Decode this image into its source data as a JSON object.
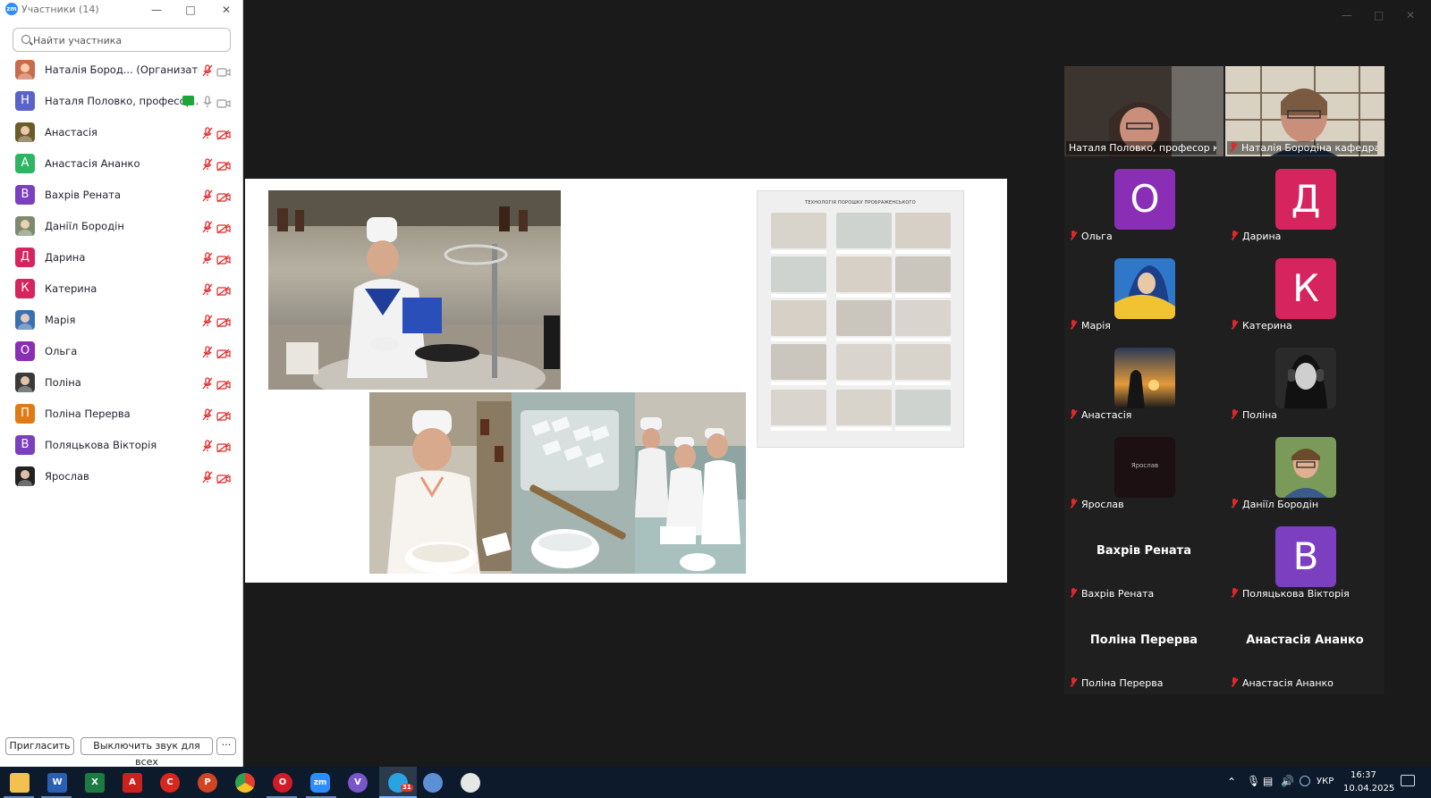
{
  "participants_panel": {
    "title": "Участники (14)",
    "app_icon": "zm",
    "window_controls": [
      "minimize",
      "maximize",
      "close"
    ],
    "search": {
      "placeholder": "Найти участника",
      "value": ""
    },
    "rows": [
      {
        "name": "Наталія Бород... (Организатор, я)",
        "avatar": "photo",
        "avatar_color": "#c96b4a",
        "mic": "muted",
        "camera": "on"
      },
      {
        "name": "Наталя Половко, професор...",
        "avatar": "Н",
        "avatar_color": "#5a63c9",
        "mic": "on",
        "camera": "on",
        "sharing": true
      },
      {
        "name": "Анастасія",
        "avatar": "photo",
        "avatar_color": "#6b5a2a",
        "mic": "muted",
        "camera": "off"
      },
      {
        "name": "Анастасія Ананко",
        "avatar": "А",
        "avatar_color": "#2fb562",
        "mic": "muted",
        "camera": "off"
      },
      {
        "name": "Вахрів Рената",
        "avatar": "В",
        "avatar_color": "#7b3fbf",
        "mic": "muted",
        "camera": "off"
      },
      {
        "name": "Даніїл Бородін",
        "avatar": "photo",
        "avatar_color": "#7c8a6e",
        "mic": "muted",
        "camera": "off"
      },
      {
        "name": "Дарина",
        "avatar": "Д",
        "avatar_color": "#d6245e",
        "mic": "muted",
        "camera": "off"
      },
      {
        "name": "Катерина",
        "avatar": "К",
        "avatar_color": "#d6245e",
        "mic": "muted",
        "camera": "off"
      },
      {
        "name": "Марія",
        "avatar": "photo",
        "avatar_color": "#3a6fb0",
        "mic": "muted",
        "camera": "off"
      },
      {
        "name": "Ольга",
        "avatar": "О",
        "avatar_color": "#8a2fb5",
        "mic": "muted",
        "camera": "off"
      },
      {
        "name": "Поліна",
        "avatar": "photo",
        "avatar_color": "#3a3a3a",
        "mic": "muted",
        "camera": "off"
      },
      {
        "name": "Поліна Перерва",
        "avatar": "П",
        "avatar_color": "#e07a14",
        "mic": "muted",
        "camera": "off"
      },
      {
        "name": "Поляцькова Вікторія",
        "avatar": "В",
        "avatar_color": "#7b3fbf",
        "mic": "muted",
        "camera": "off"
      },
      {
        "name": "Ярослав",
        "avatar": "photo",
        "avatar_color": "#222222",
        "mic": "muted",
        "camera": "off"
      }
    ],
    "buttons": {
      "invite": "Пригласить",
      "mute_all": "Выключить звук для всех",
      "more": "···"
    }
  },
  "slide": {
    "document_title": "ТЕХНОЛОГІЯ ПОРОШКУ ПРОБРАЖЕНСЬКОГО"
  },
  "gallery": {
    "tiles": [
      {
        "label": "Наталя Половко, професор ка...",
        "type": "video",
        "active": true,
        "muted": false
      },
      {
        "label": "Наталія Бородіна кафедра ф...",
        "type": "video",
        "active": false,
        "muted": true
      },
      {
        "label": "Ольга",
        "type": "letter",
        "letter": "О",
        "color": "#8a2fb5",
        "muted": true
      },
      {
        "label": "Дарина",
        "type": "letter",
        "letter": "Д",
        "color": "#d6245e",
        "muted": true
      },
      {
        "label": "Марія",
        "type": "photo",
        "muted": true
      },
      {
        "label": "Катерина",
        "type": "letter",
        "letter": "К",
        "color": "#d6245e",
        "muted": true
      },
      {
        "label": "Анастасія",
        "type": "photo",
        "muted": true
      },
      {
        "label": "Поліна",
        "type": "photo",
        "muted": true
      },
      {
        "label": "Ярослав",
        "type": "photo",
        "photo_text": "Ярослав",
        "muted": true
      },
      {
        "label": "Даніїл Бородін",
        "type": "photo",
        "muted": true
      },
      {
        "label": "Вахрів Рената",
        "type": "name",
        "bigname": "Вахрів Рената",
        "muted": true
      },
      {
        "label": "Поляцькова Вікторія",
        "type": "letter",
        "letter": "В",
        "color": "#7b3fbf",
        "muted": true
      },
      {
        "label": "Поліна Перерва",
        "type": "name",
        "bigname": "Поліна Перерва",
        "muted": true
      },
      {
        "label": "Анастасія Ананко",
        "type": "name",
        "bigname": "Анастасія Ананко",
        "muted": true
      }
    ]
  },
  "taskbar": {
    "apps": [
      "file-explorer",
      "word",
      "excel",
      "acrobat",
      "acrobat-reader",
      "powerpoint",
      "chrome",
      "opera",
      "zoom",
      "viber",
      "telegram",
      "paint",
      "paint-3d"
    ],
    "telegram_badge": "31",
    "language": "УКР",
    "time": "16:37",
    "date": "10.04.2025"
  },
  "colors": {
    "zoom_blue": "#2d8cff",
    "active_speaker": "#23d959",
    "muted_red": "#e02828",
    "taskbar": "#0c1a2b"
  }
}
